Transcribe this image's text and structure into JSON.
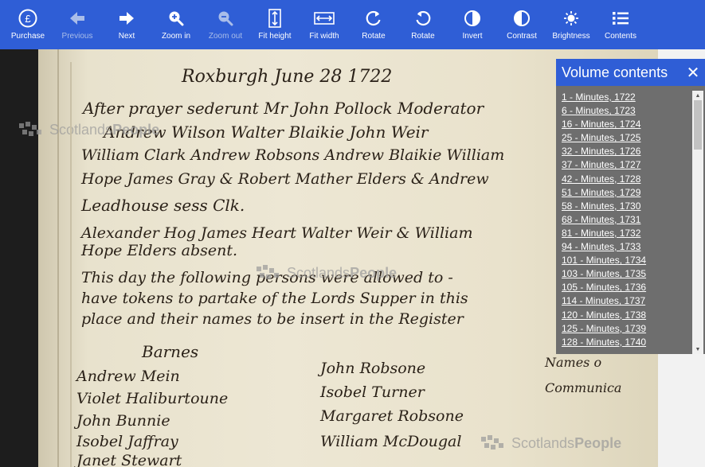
{
  "toolbar": {
    "items": [
      {
        "label": "Purchase",
        "icon": "pound-circle-icon",
        "disabled": false
      },
      {
        "label": "Previous",
        "icon": "arrow-left-icon",
        "disabled": true
      },
      {
        "label": "Next",
        "icon": "arrow-right-icon",
        "disabled": false
      },
      {
        "label": "Zoom in",
        "icon": "zoom-in-icon",
        "disabled": false
      },
      {
        "label": "Zoom out",
        "icon": "zoom-out-icon",
        "disabled": true
      },
      {
        "label": "Fit height",
        "icon": "fit-height-icon",
        "disabled": false
      },
      {
        "label": "Fit width",
        "icon": "fit-width-icon",
        "disabled": false
      },
      {
        "label": "Rotate",
        "icon": "rotate-ccw-icon",
        "disabled": false
      },
      {
        "label": "Rotate",
        "icon": "rotate-cw-icon",
        "disabled": false
      },
      {
        "label": "Invert",
        "icon": "invert-icon",
        "disabled": false
      },
      {
        "label": "Contrast",
        "icon": "contrast-icon",
        "disabled": false
      },
      {
        "label": "Brightness",
        "icon": "sun-icon",
        "disabled": false
      },
      {
        "label": "Contents",
        "icon": "list-icon",
        "disabled": false
      }
    ]
  },
  "panel": {
    "title": "Volume contents",
    "close": "✕",
    "items": [
      "1 - Minutes, 1722",
      "6 - Minutes, 1723",
      "16 - Minutes, 1724",
      "25 - Minutes, 1725",
      "32 - Minutes, 1726",
      "37 - Minutes, 1727",
      "42 - Minutes, 1728",
      "51 - Minutes, 1729",
      "58 - Minutes, 1730",
      "68 - Minutes, 1731",
      "81 - Minutes, 1732",
      "94 - Minutes, 1733",
      "101 - Minutes, 1734",
      "103 - Minutes, 1735",
      "105 - Minutes, 1736",
      "114 - Minutes, 1737",
      "120 - Minutes, 1738",
      "125 - Minutes, 1739",
      "128 - Minutes, 1740"
    ]
  },
  "watermark": {
    "part1": "Scotlands",
    "part2": "People"
  },
  "manuscript": {
    "lines": [
      "Roxburgh June 28 1722",
      "After prayer sederunt Mr John Pollock Moderator",
      "Andrew Wilson Walter Blaikie John Weir",
      "William Clark Andrew Robsons Andrew Blaikie William",
      "Hope James Gray & Robert Mather Elders & Andrew",
      "Leadhouse sess Clk.",
      "Alexander Hog James Heart Walter Weir & William",
      "Hope Elders absent.",
      "This day the following persons were allowed to -",
      "have tokens to partake of the Lords Supper in this",
      "place and their names to be insert in the Register",
      "Barnes",
      "Andrew Mein",
      "Violet Haliburtoune",
      "John Bunnie",
      "Isobel Jaffray",
      "Janet Stewart",
      "John Robsone",
      "Isobel Turner",
      "Margaret Robsone",
      "William McDougal",
      "Names o",
      "Communica"
    ]
  },
  "colors": {
    "toolbar": "#2f5ed6",
    "panel": "#6e6e6e",
    "parchment": "#ede7d4"
  }
}
